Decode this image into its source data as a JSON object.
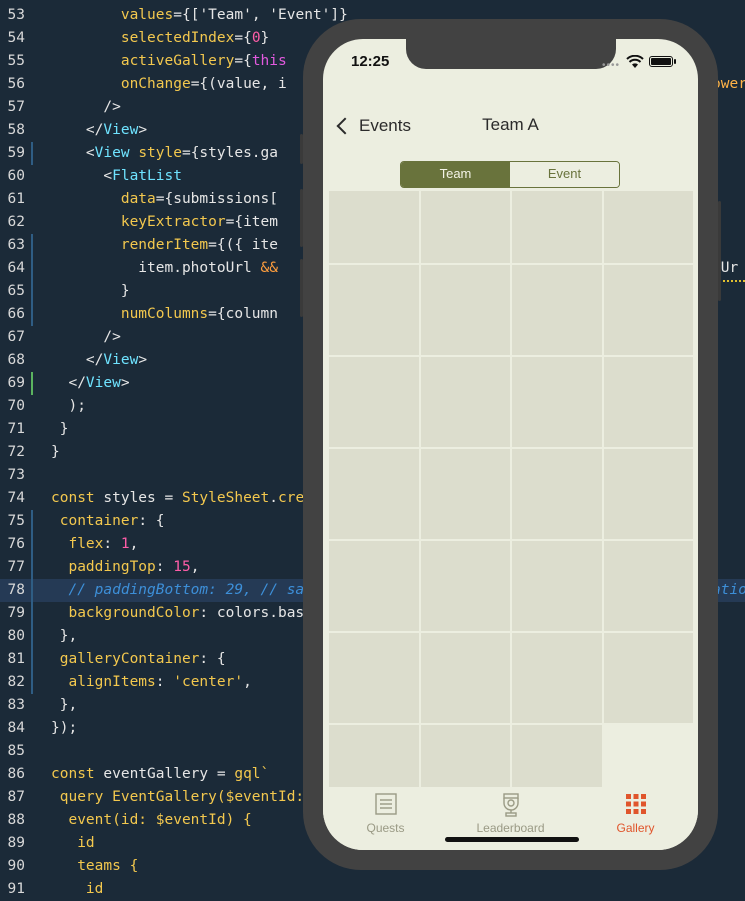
{
  "editor": {
    "lines": [
      {
        "n": "53",
        "segs": [
          [
            "        ",
            "w"
          ],
          [
            "values",
            "y"
          ],
          [
            "={[",
            "w"
          ],
          [
            "'Team'",
            "w"
          ],
          [
            ", ",
            "w"
          ],
          [
            "'Event'",
            "w"
          ],
          [
            "]}",
            "w"
          ]
        ]
      },
      {
        "n": "54",
        "segs": [
          [
            "        ",
            "w"
          ],
          [
            "selectedIndex",
            "y"
          ],
          [
            "={",
            "w"
          ],
          [
            "0",
            "p"
          ],
          [
            "}",
            "w"
          ]
        ]
      },
      {
        "n": "55",
        "segs": [
          [
            "        ",
            "w"
          ],
          [
            "activeGallery",
            "y"
          ],
          [
            "={",
            "w"
          ],
          [
            "this",
            "pk"
          ]
        ]
      },
      {
        "n": "56",
        "segs": [
          [
            "        ",
            "w"
          ],
          [
            "onChange",
            "y"
          ],
          [
            "={(value, i",
            "w"
          ]
        ]
      },
      {
        "n": "57",
        "segs": [
          [
            "      />",
            "w"
          ]
        ]
      },
      {
        "n": "58",
        "segs": [
          [
            "    </",
            "w"
          ],
          [
            "View",
            "c"
          ],
          [
            ">",
            "w"
          ]
        ]
      },
      {
        "n": "59",
        "segs": [
          [
            "    <",
            "w"
          ],
          [
            "View",
            "c"
          ],
          [
            " ",
            "w"
          ],
          [
            "style",
            "y"
          ],
          [
            "={styles.ga",
            "w"
          ]
        ]
      },
      {
        "n": "60",
        "segs": [
          [
            "      <",
            "w"
          ],
          [
            "FlatList",
            "c"
          ]
        ]
      },
      {
        "n": "61",
        "segs": [
          [
            "        ",
            "w"
          ],
          [
            "data",
            "y"
          ],
          [
            "={submissions[",
            "w"
          ]
        ]
      },
      {
        "n": "62",
        "segs": [
          [
            "        ",
            "w"
          ],
          [
            "keyExtractor",
            "y"
          ],
          [
            "={item",
            "w"
          ]
        ]
      },
      {
        "n": "63",
        "segs": [
          [
            "        ",
            "w"
          ],
          [
            "renderItem",
            "y"
          ],
          [
            "={({ ite",
            "w"
          ]
        ]
      },
      {
        "n": "64",
        "segs": [
          [
            "          item.photoUrl ",
            "w"
          ],
          [
            "&&",
            "o"
          ]
        ]
      },
      {
        "n": "65",
        "segs": [
          [
            "        }",
            "w"
          ]
        ]
      },
      {
        "n": "66",
        "segs": [
          [
            "        ",
            "w"
          ],
          [
            "numColumns",
            "y"
          ],
          [
            "={column",
            "w"
          ]
        ]
      },
      {
        "n": "67",
        "segs": [
          [
            "      />",
            "w"
          ]
        ]
      },
      {
        "n": "68",
        "segs": [
          [
            "    </",
            "w"
          ],
          [
            "View",
            "c"
          ],
          [
            ">",
            "w"
          ]
        ]
      },
      {
        "n": "69",
        "segs": [
          [
            "  </",
            "w"
          ],
          [
            "View",
            "c"
          ],
          [
            ">",
            "w"
          ]
        ]
      },
      {
        "n": "70",
        "segs": [
          [
            "  );",
            "w"
          ]
        ]
      },
      {
        "n": "71",
        "segs": [
          [
            " }",
            "w"
          ]
        ]
      },
      {
        "n": "72",
        "segs": [
          [
            "}",
            "w"
          ]
        ]
      },
      {
        "n": "73",
        "segs": []
      },
      {
        "n": "74",
        "segs": [
          [
            "const",
            "y"
          ],
          [
            " styles = ",
            "w"
          ],
          [
            "StyleSheet",
            "y"
          ],
          [
            ".",
            "w"
          ],
          [
            "creat",
            "y"
          ]
        ]
      },
      {
        "n": "75",
        "segs": [
          [
            " container",
            "y"
          ],
          [
            ": {",
            "w"
          ]
        ]
      },
      {
        "n": "76",
        "segs": [
          [
            "  flex",
            "y"
          ],
          [
            ": ",
            "w"
          ],
          [
            "1",
            "p"
          ],
          [
            ",",
            "w"
          ]
        ]
      },
      {
        "n": "77",
        "segs": [
          [
            "  paddingTop",
            "y"
          ],
          [
            ": ",
            "w"
          ],
          [
            "15",
            "p"
          ],
          [
            ",",
            "w"
          ]
        ]
      },
      {
        "n": "78",
        "segs": [
          [
            "  // paddingBottom: 29, // sa",
            "cm"
          ]
        ]
      },
      {
        "n": "79",
        "segs": [
          [
            "  backgroundColor",
            "y"
          ],
          [
            ": colors.bas",
            "w"
          ]
        ]
      },
      {
        "n": "80",
        "segs": [
          [
            " },",
            "w"
          ]
        ]
      },
      {
        "n": "81",
        "segs": [
          [
            " galleryContainer",
            "y"
          ],
          [
            ": {",
            "w"
          ]
        ]
      },
      {
        "n": "82",
        "segs": [
          [
            "  alignItems",
            "y"
          ],
          [
            ": ",
            "w"
          ],
          [
            "'center'",
            "y"
          ],
          [
            ",",
            "w"
          ]
        ]
      },
      {
        "n": "83",
        "segs": [
          [
            " },",
            "w"
          ]
        ]
      },
      {
        "n": "84",
        "segs": [
          [
            "});",
            "w"
          ]
        ]
      },
      {
        "n": "85",
        "segs": []
      },
      {
        "n": "86",
        "segs": [
          [
            "const",
            "y"
          ],
          [
            " eventGallery = ",
            "w"
          ],
          [
            "gql",
            "y"
          ],
          [
            "`",
            "y"
          ]
        ]
      },
      {
        "n": "87",
        "segs": [
          [
            " query EventGallery($eventId:",
            "y"
          ]
        ]
      },
      {
        "n": "88",
        "segs": [
          [
            "  event(id: $eventId) {",
            "y"
          ]
        ]
      },
      {
        "n": "89",
        "segs": [
          [
            "   id",
            "y"
          ]
        ]
      },
      {
        "n": "90",
        "segs": [
          [
            "   teams {",
            "y"
          ]
        ]
      },
      {
        "n": "91",
        "segs": [
          [
            "    id",
            "y"
          ]
        ]
      }
    ],
    "right_fragments": [
      {
        "line": "56",
        "text": "ower",
        "color": "r"
      },
      {
        "line": "64",
        "text": "oUr",
        "color": "w"
      },
      {
        "line": "78",
        "text": "atio",
        "color": "cm"
      }
    ]
  },
  "phone": {
    "status": {
      "time": "12:25",
      "dots": "••••"
    },
    "nav": {
      "back_label": "Events",
      "title": "Team A"
    },
    "segmented": {
      "options": [
        "Team",
        "Event"
      ],
      "selected": "Team"
    },
    "gallery": {
      "columns": 4,
      "rows_full": 6,
      "last_row": 3,
      "placeholder_color": "#dcddcd"
    },
    "tabs": [
      {
        "label": "Quests",
        "icon": "list-icon",
        "active": false
      },
      {
        "label": "Leaderboard",
        "icon": "trophy-icon",
        "active": false
      },
      {
        "label": "Gallery",
        "icon": "grid-icon",
        "active": true
      }
    ],
    "colors": {
      "accent": "#69733c",
      "tab_active": "#e0552c",
      "tab_inactive": "#9a9a85",
      "background": "#eceee0"
    }
  }
}
